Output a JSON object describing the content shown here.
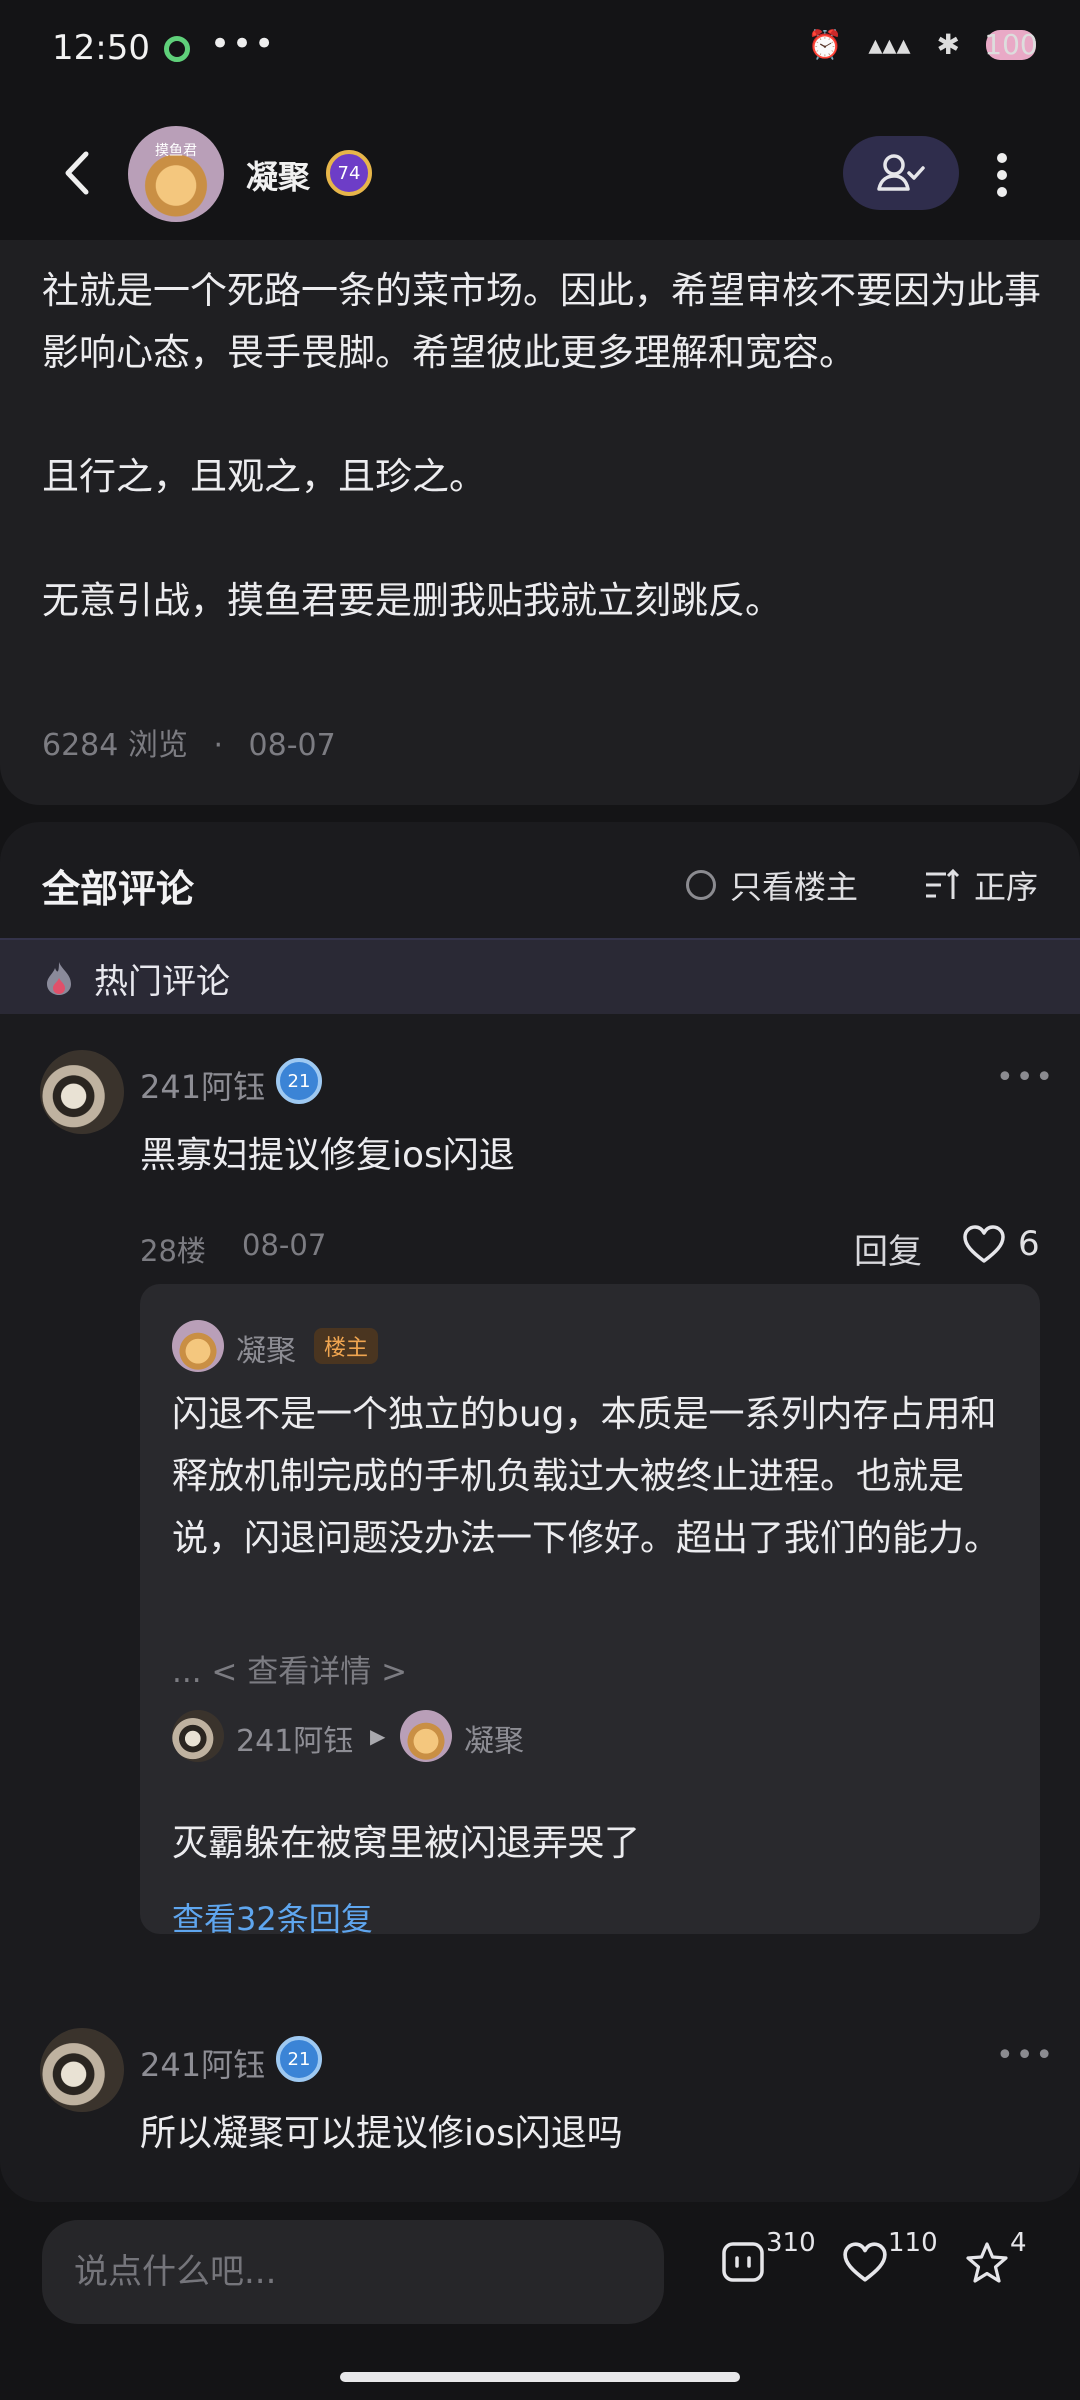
{
  "status_bar": {
    "time": "12:50",
    "battery": "100"
  },
  "header": {
    "title": "凝聚",
    "level": "74",
    "avatar_text": "摸鱼君"
  },
  "post": {
    "text": "社就是一个死路一条的菜市场。因此，希望审核不要因为此事影响心态，畏手畏脚。希望彼此更多理解和宽容。\n\n且行之，且观之，且珍之。\n\n无意引战，摸鱼君要是删我贴我就立刻跳反。",
    "views": "6284 浏览",
    "separator": "·",
    "date": "08-07"
  },
  "comments_header": {
    "title": "全部评论",
    "only_op_label": "只看楼主",
    "sort_label": "正序"
  },
  "hot_section": {
    "label": "热门评论"
  },
  "comments": [
    {
      "user": "241阿钰",
      "badge": "21",
      "text": "黑寡妇提议修复ios闪退",
      "floor": "28楼",
      "date": "08-07",
      "reply_label": "回复",
      "likes": "6",
      "replies": {
        "op_name": "凝聚",
        "op_tag": "楼主",
        "op_text": "闪退不是一个独立的bug，本质是一系列内存占用和释放机制完成的手机负载过大被终止进程。也就是说，闪退问题没办法一下修好。超出了我们的能力。",
        "expand_label": "... < 查看详情 >",
        "sub_from": "241阿钰",
        "sub_to": "凝聚",
        "sub_text": "灭霸躲在被窝里被闪退弄哭了",
        "view_more": "查看32条回复"
      }
    },
    {
      "user": "241阿钰",
      "badge": "21",
      "text": "所以凝聚可以提议修ios闪退吗"
    }
  ],
  "bottom_bar": {
    "placeholder": "说点什么吧...",
    "comments_count": "310",
    "likes_count": "110",
    "favorites_count": "4"
  }
}
